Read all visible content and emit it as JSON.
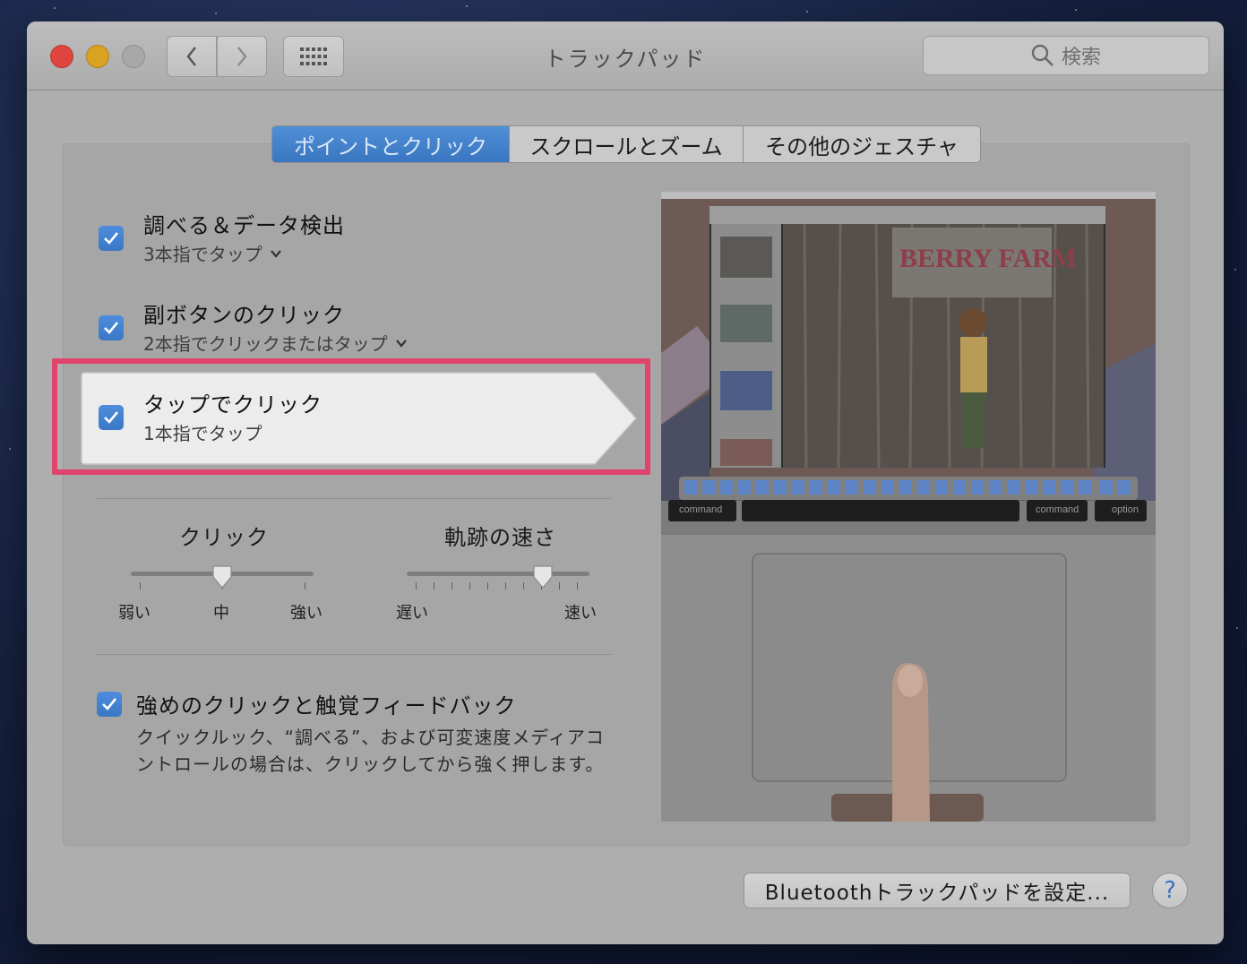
{
  "window": {
    "title": "トラックパッド",
    "search_placeholder": "検索"
  },
  "tabs": [
    {
      "label": "ポイントとクリック",
      "active": true
    },
    {
      "label": "スクロールとズーム",
      "active": false
    },
    {
      "label": "その他のジェスチャ",
      "active": false
    }
  ],
  "options": [
    {
      "title": "調べる＆データ検出",
      "subtitle": "3本指でタップ",
      "checked": true,
      "has_dropdown": true
    },
    {
      "title": "副ボタンのクリック",
      "subtitle": "2本指でクリックまたはタップ",
      "checked": true,
      "has_dropdown": true
    },
    {
      "title": "タップでクリック",
      "subtitle": "1本指でタップ",
      "checked": true,
      "has_dropdown": false,
      "selected": true
    }
  ],
  "sliders": {
    "click": {
      "title": "クリック",
      "labels": [
        "弱い",
        "中",
        "強い"
      ],
      "value": "中"
    },
    "tracking": {
      "title": "軌跡の速さ",
      "labels": [
        "遅い",
        "速い"
      ],
      "value_fraction": 0.8
    }
  },
  "force_click": {
    "title": "強めのクリックと触覚フィードバック",
    "description": "クイックルック、“調べる”、および可変速度メディアコントロールの場合は、クリックしてから強く押します。",
    "checked": true
  },
  "preview": {
    "key_labels": [
      "command",
      "command",
      "option"
    ],
    "sign_text": "BERRY FARM"
  },
  "footer": {
    "bluetooth_button": "Bluetoothトラックパッドを設定...",
    "help_button": "?"
  },
  "colors": {
    "accent": "#3a78c6",
    "highlight": "#e0436b"
  }
}
